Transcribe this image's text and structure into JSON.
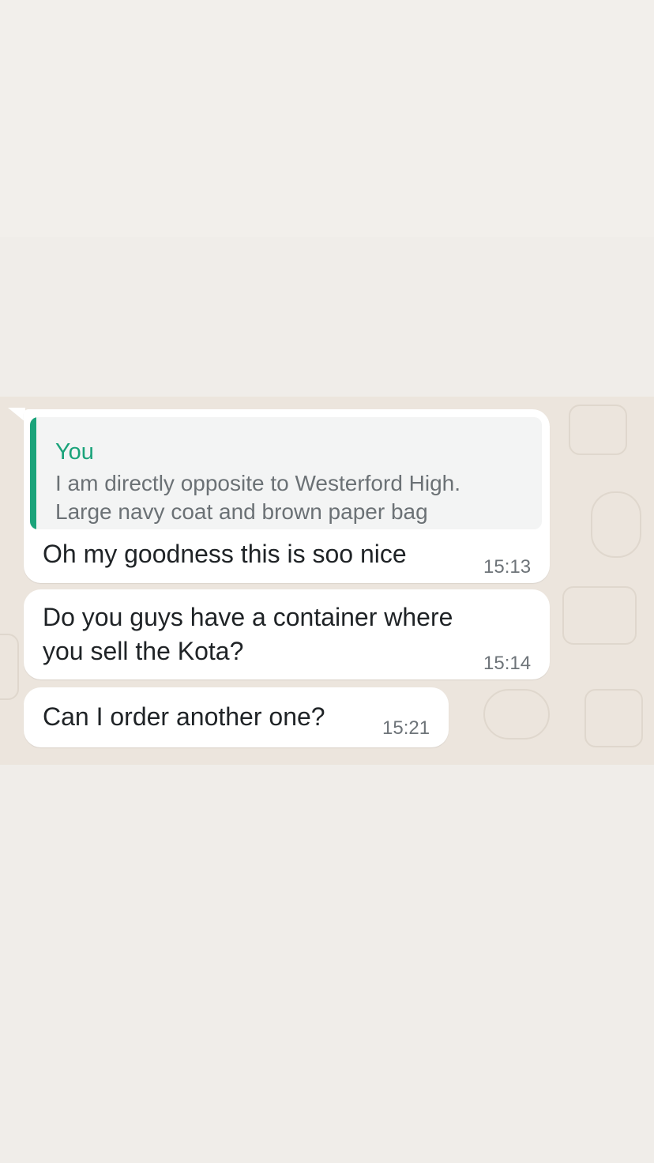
{
  "chat": {
    "messages": [
      {
        "quote": {
          "author": "You",
          "text_line1": "I am directly opposite to Westerford High.",
          "text_line2": "Large navy coat and brown paper bag"
        },
        "text": "Oh my goodness this is soo nice",
        "time": "15:13"
      },
      {
        "text_line1": "Do you guys have a container where",
        "text_line2": "you sell the Kota?",
        "time": "15:14"
      },
      {
        "text": "Can I order another one?",
        "time": "15:21"
      }
    ]
  },
  "colors": {
    "quote_accent": "#1aa37a",
    "bubble": "#ffffff",
    "wallpaper": "#ece5dd",
    "page_background": "#f0ede9"
  }
}
